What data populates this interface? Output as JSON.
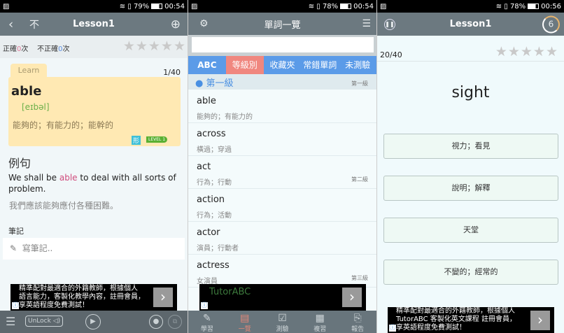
{
  "screen1": {
    "status": {
      "battery": "79%",
      "time": "00:54"
    },
    "header": {
      "title": "Lesson1",
      "back_icon": "‹",
      "char_icon": "不",
      "add_icon": "⊕"
    },
    "stats": {
      "correct_label": "正確",
      "correct_count": "0",
      "correct_suffix": "次",
      "incorrect_label": "不正確",
      "incorrect_count": "0",
      "incorrect_suffix": "次"
    },
    "card": {
      "tab": "Learn",
      "counter": "1/40",
      "word": "able",
      "phonetic": "[eɪbəl]",
      "meaning": "能夠的；有能力的；能幹的",
      "pos": "形",
      "level": "LEVEL 1"
    },
    "example": {
      "heading": "例句",
      "before": "We shall be ",
      "highlight": "able",
      "after": " to deal with all sorts of problem.",
      "translation": "我們應該能夠應付各種困難。"
    },
    "notes": {
      "heading": "筆記",
      "placeholder": "寫筆記.."
    },
    "ad": {
      "lines": [
        "精準配對最適合的外籍教師，根據個人",
        "語言能力，客製化教學內容，註冊會員，",
        "享英語程度免費測試！"
      ]
    },
    "toolbar": {
      "unlock": "UnLock"
    }
  },
  "screen2": {
    "status": {
      "battery": "78%",
      "time": "00:54"
    },
    "header": {
      "title": "單詞一覽"
    },
    "search": {
      "value": ""
    },
    "tabs": [
      {
        "label": "ABC"
      },
      {
        "label": "等級別"
      },
      {
        "label": "收藏夾"
      },
      {
        "label": "常錯單詞"
      },
      {
        "label": "未測驗"
      }
    ],
    "group": {
      "title": "第一級",
      "tag": "第一級"
    },
    "words": [
      {
        "word": "able",
        "meaning": "能夠的；有能力的",
        "level": ""
      },
      {
        "word": "across",
        "meaning": "橫過；穿過",
        "level": ""
      },
      {
        "word": "act",
        "meaning": "行為；行動",
        "level": "第二級"
      },
      {
        "word": "action",
        "meaning": "行為；活動",
        "level": ""
      },
      {
        "word": "actor",
        "meaning": "演員；行動者",
        "level": ""
      },
      {
        "word": "actress",
        "meaning": "女演員",
        "level": "第三級"
      }
    ],
    "ad": {
      "text": "TutorABC"
    },
    "nav": [
      {
        "label": "學習"
      },
      {
        "label": "一覽"
      },
      {
        "label": "測驗"
      },
      {
        "label": "複習"
      },
      {
        "label": "報告"
      }
    ]
  },
  "screen3": {
    "status": {
      "battery": "78%",
      "time": "00:56"
    },
    "header": {
      "title": "Lesson1",
      "timer": "6"
    },
    "counter": "20/40",
    "word": "sight",
    "options": [
      {
        "label": "視力；看見"
      },
      {
        "label": "說明；解釋"
      },
      {
        "label": "天堂"
      },
      {
        "label": "不變的；經常的"
      }
    ],
    "ad": {
      "lines": [
        "精準配對最適合的外籍教師，根據個人",
        "TutorABC 客製化英文課程 註冊會員，",
        "享英語程度免費測試！"
      ]
    }
  },
  "colors": {
    "header": "#6c7980",
    "tab_blue": "#5b9be8",
    "tab_selected": "#f0877f",
    "card": "#ffe9b3",
    "highlight": "#d04b7c"
  }
}
